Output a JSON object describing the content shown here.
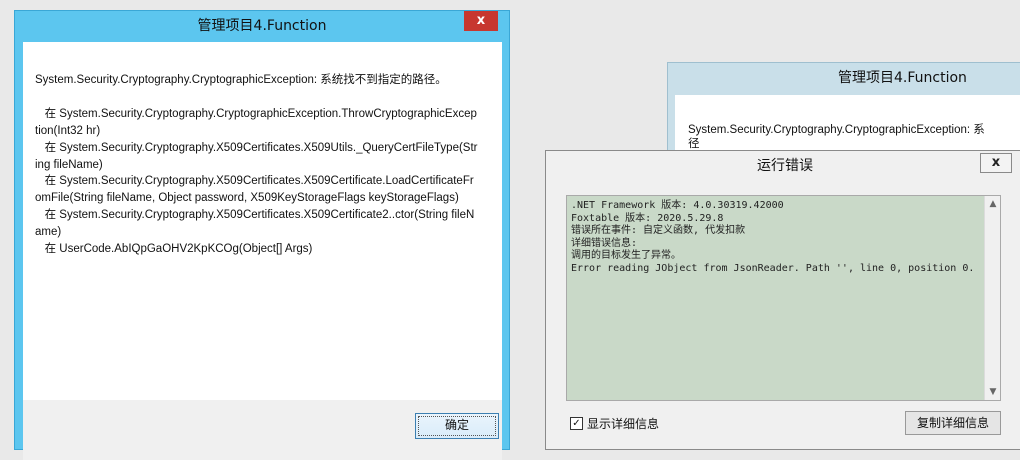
{
  "main_dialog": {
    "title": "管理项目4.Function",
    "close_label": "x",
    "message": "System.Security.Cryptography.CryptographicException: 系统找不到指定的路径。\n\n   在 System.Security.Cryptography.CryptographicException.ThrowCryptographicException(Int32 hr)\n   在 System.Security.Cryptography.X509Certificates.X509Utils._QueryCertFileType(String fileName)\n   在 System.Security.Cryptography.X509Certificates.X509Certificate.LoadCertificateFromFile(String fileName, Object password, X509KeyStorageFlags keyStorageFlags)\n   在 System.Security.Cryptography.X509Certificates.X509Certificate2..ctor(String fileName)\n   在 UserCode.AbIQpGaOHV2KpKCOg(Object[] Args)",
    "ok_label": "确定"
  },
  "back_dialog": {
    "title": "管理项目4.Function",
    "message": "System.Security.Cryptography.CryptographicException: 系\n径"
  },
  "error_dialog": {
    "title": "运行错误",
    "close_label": "x",
    "detail": ".NET Framework 版本: 4.0.30319.42000\nFoxtable 版本: 2020.5.29.8\n错误所在事件: 自定义函数, 代发扣款\n详细错误信息:\n调用的目标发生了异常。\nError reading JObject from JsonReader. Path '', line 0, position 0.",
    "show_detail_label": "显示详细信息",
    "show_detail_checked": true,
    "copy_label": "复制详细信息"
  },
  "colors": {
    "active_title": "#5cc6ef",
    "close_red": "#c7372f",
    "detail_bg": "#c9d9c8"
  }
}
